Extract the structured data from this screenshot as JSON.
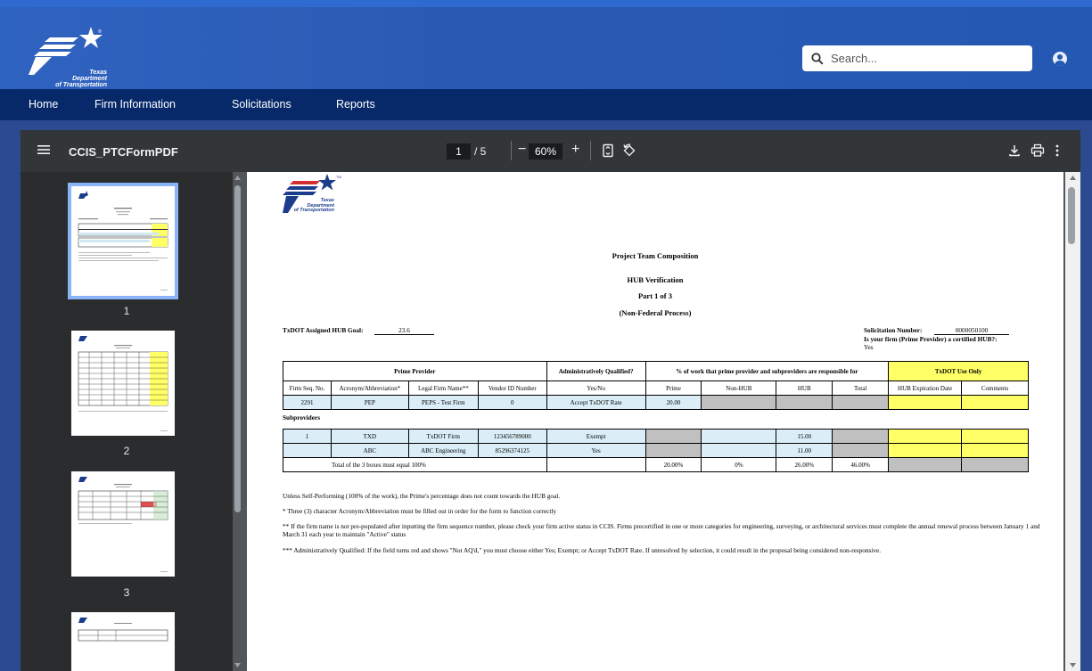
{
  "header": {
    "logo_lines": [
      "Texas",
      "Department",
      "of Transportation"
    ],
    "search_placeholder": "Search..."
  },
  "nav": {
    "items": [
      "Home",
      "Firm Information",
      "Solicitations",
      "Reports"
    ]
  },
  "viewer": {
    "title": "CCIS_PTCFormPDF",
    "current_page": "1",
    "total_pages": "/ 5",
    "zoom": "60%",
    "zoom_out": "−",
    "zoom_in": "+",
    "thumbnails": [
      "1",
      "2",
      "3"
    ]
  },
  "document": {
    "logo_lines": [
      "Texas",
      "Department",
      "of Transportation"
    ],
    "title": "Project Team Composition",
    "subtitle1": "HUB Verification",
    "subtitle2": "Part 1 of 3",
    "subtitle3": "(Non-Federal Process)",
    "hub_goal_label": "TxDOT Assigned HUB Goal:",
    "hub_goal_value": "23.6",
    "solicitation_label": "Solicitation Number:",
    "solicitation_value": "0000050100",
    "certified_hub_q": "Is your firm (Prime Provider) a certified HUB?:",
    "certified_hub_a": "Yes",
    "table": {
      "group_prime": "Prime Provider",
      "group_admin": "Administratively Qualified?",
      "group_pct": "% of work that prime provider and subproviders are responsible for",
      "group_txdot": "TxDOT Use Only",
      "columns": [
        "Firm Seq. No.",
        "Acronym/Abbreviation*",
        "Legal Firm Name**",
        "Vendor ID Number",
        "Yes/No",
        "Prime",
        "Non-HUB",
        "HUB",
        "Total",
        "HUB Expiration Date",
        "Comments"
      ],
      "prime_row": [
        "2291",
        "PEP",
        "PEPS - Test Firm",
        "0",
        "Accept TxDOT Rate",
        "20.00"
      ],
      "subproviders_label": "Subproviders",
      "sub_rows": [
        [
          "1",
          "TXD",
          "TxDOT Firm",
          "123456789000",
          "Exempt",
          "15.00"
        ],
        [
          "",
          "ABC",
          "ABC Engineering",
          "85296374125",
          "Yes",
          "11.00"
        ]
      ],
      "total_label": "Total of the 3 boxes must equal 100%",
      "totals": [
        "20.00%",
        "0%",
        "26.00%",
        "46.00%"
      ]
    },
    "notes": [
      "Unless Self-Performing (100% of the work), the Prime's percentage does not count towards the HUB goal.",
      "* Three (3) character Acronym/Abbreviation must be filled out in order for the form to function correctly",
      "** If the firm name is not pre-populated after inputting the firm sequence number, please check your firm active status in CCIS. Firms precertified in one or more categories for engineering, surveying, or architectural services must complete the annual renewal process between January 1 and March 31 each year to maintain \"Active\" status",
      "*** Administratively Qualified: If the field turns red and shows \"Not AQ'd,\" you must choose either Yes; Exempt; or Accept TxDOT Rate. If unresolved by selection, it could result in the proposal being considered non-responsive."
    ]
  }
}
